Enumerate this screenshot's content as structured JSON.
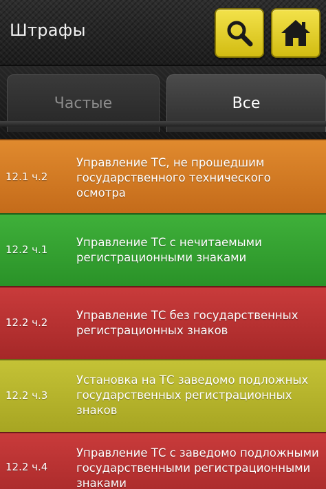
{
  "header": {
    "title": "Штрафы"
  },
  "tabs": [
    {
      "label": "Частые",
      "active": false
    },
    {
      "label": "Все",
      "active": true
    }
  ],
  "fines": [
    {
      "code": "12.1 ч.2",
      "description": "Управление ТС, не прошедшим государственного технического осмотра",
      "color": "#d07a24"
    },
    {
      "code": "12.2 ч.1",
      "description": "Управление ТС с нечитаемыми регистрационными знаками",
      "color": "#35a231"
    },
    {
      "code": "12.2 ч.2",
      "description": "Управление ТС без государственных регистрационных знаков",
      "color": "#b73232"
    },
    {
      "code": "12.2 ч.3",
      "description": "Установка на ТС заведомо подложных государственных регистрационных знаков",
      "color": "#b6b42c"
    },
    {
      "code": "12.2 ч.4",
      "description": "Управление ТС с заведомо подложными государственными регистрационными знаками",
      "color": "#b73232"
    }
  ],
  "icons": {
    "search": "magnifier-icon",
    "home": "house-icon"
  }
}
